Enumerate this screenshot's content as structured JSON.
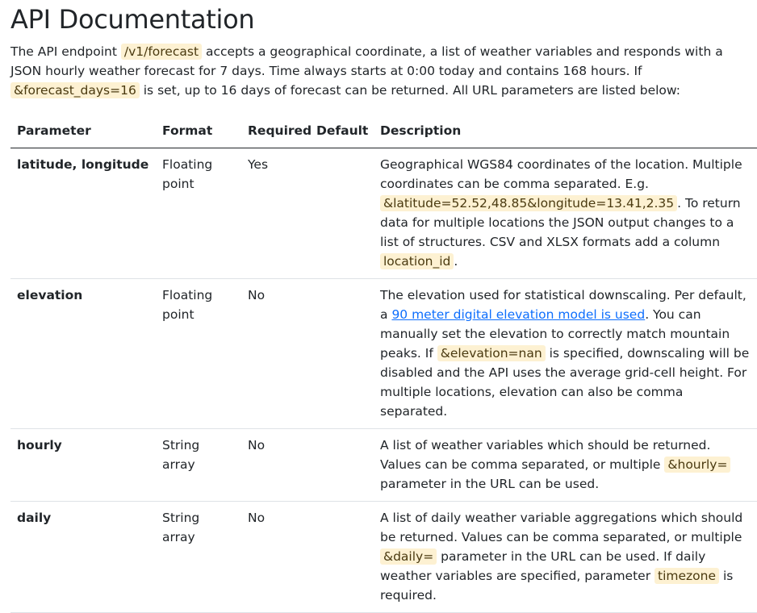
{
  "title": "API Documentation",
  "intro": {
    "t1": "The API endpoint ",
    "endpoint": "/v1/forecast",
    "t2": " accepts a geographical coordinate, a list of weather variables and responds with a JSON hourly weather forecast for 7 days. Time always starts at 0:00 today and contains 168 hours. If ",
    "param": "&forecast_days=16",
    "t3": " is set, up to 16 days of forecast can be returned. All URL parameters are listed below:"
  },
  "table": {
    "headers": [
      "Parameter",
      "Format",
      "Required",
      "Default",
      "Description"
    ],
    "rows": [
      {
        "parameter": "latitude, longitude",
        "format": "Floating point",
        "required": "Yes",
        "default": "",
        "desc": {
          "a": "Geographical WGS84 coordinates of the location. Multiple coordinates can be comma separated. E.g. ",
          "code1": "&latitude=52.52,48.85&longitude=13.41,2.35",
          "b": ". To return data for multiple locations the JSON output changes to a list of structures. CSV and XLSX formats add a column ",
          "code2": "location_id",
          "c": "."
        }
      },
      {
        "parameter": "elevation",
        "format": "Floating point",
        "required": "No",
        "default": "",
        "desc": {
          "a": "The elevation used for statistical downscaling. Per default, a ",
          "link": "90 meter digital elevation model is used",
          "b": ". You can manually set the elevation to correctly match mountain peaks. If ",
          "code1": "&elevation=nan",
          "c": " is specified, downscaling will be disabled and the API uses the average grid-cell height. For multiple locations, elevation can also be comma separated."
        }
      },
      {
        "parameter": "hourly",
        "format": "String array",
        "required": "No",
        "default": "",
        "desc": {
          "a": "A list of weather variables which should be returned. Values can be comma separated, or multiple ",
          "code1": "&hourly=",
          "b": " parameter in the URL can be used."
        }
      },
      {
        "parameter": "daily",
        "format": "String array",
        "required": "No",
        "default": "",
        "desc": {
          "a": "A list of daily weather variable aggregations which should be returned. Values can be comma separated, or multiple ",
          "code1": "&daily=",
          "b": " parameter in the URL can be used. If daily weather variables are specified, parameter ",
          "code2": "timezone",
          "c": " is required."
        }
      }
    ]
  }
}
